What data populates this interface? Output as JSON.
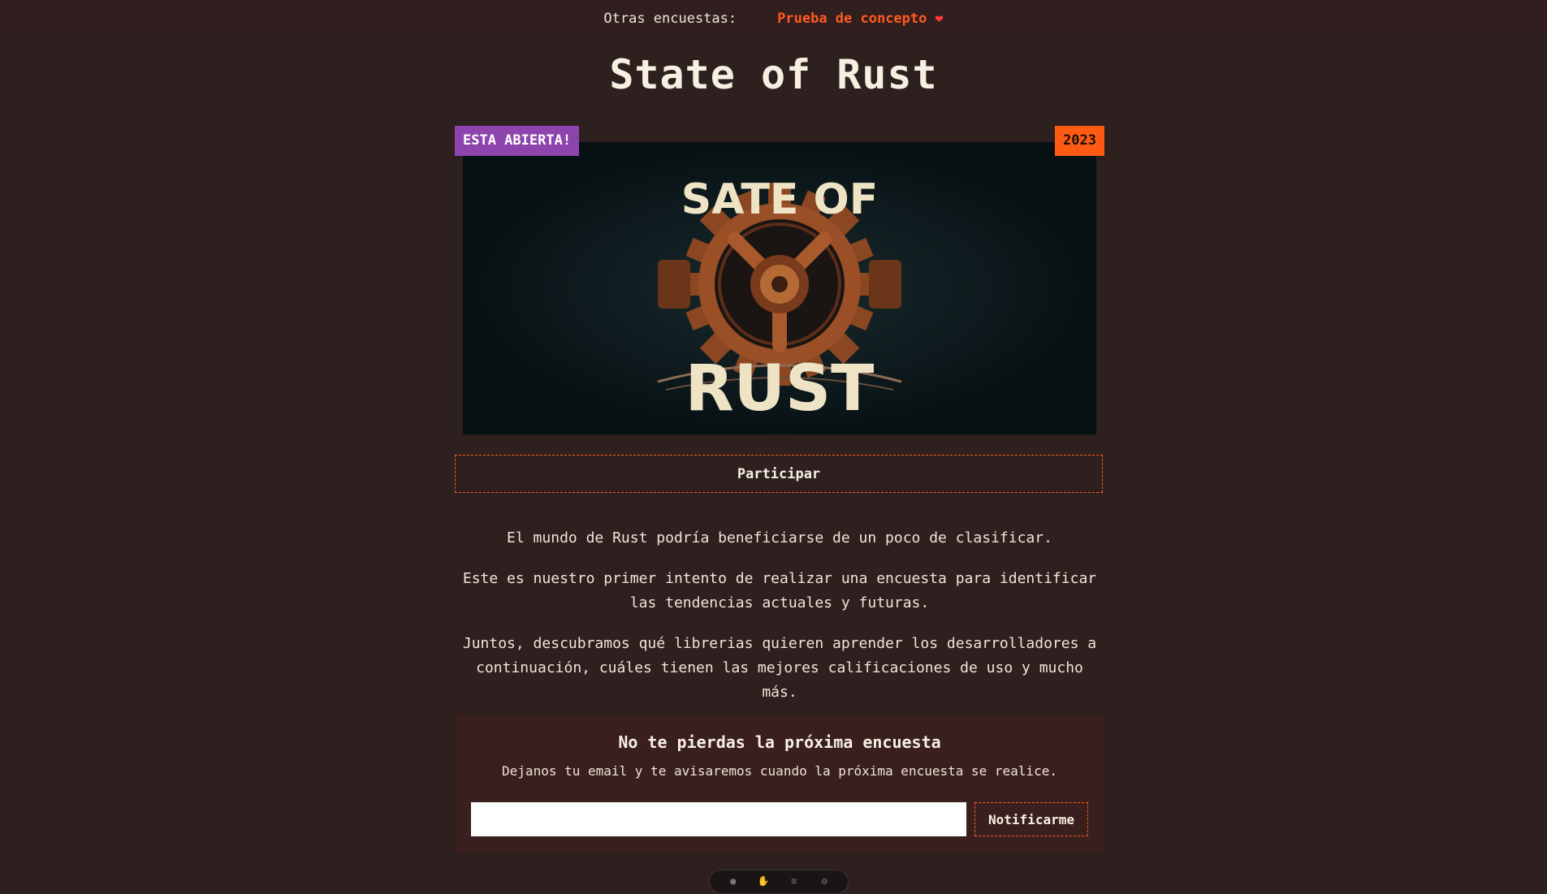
{
  "topbar": {
    "label": "Otras encuestas:",
    "link": "Prueba de concepto",
    "heart": "❤"
  },
  "title": "State of Rust",
  "card": {
    "badge_open": "ESTA ABIERTA!",
    "badge_year": "2023",
    "logo_top": "SATE OF",
    "logo_bottom": "RUST"
  },
  "cta": {
    "participate": "Participar"
  },
  "intro": {
    "p1": "El mundo de Rust podría beneficiarse de un poco de clasificar.",
    "p2": "Este es nuestro primer intento de realizar una encuesta para identificar las tendencias actuales y futuras.",
    "p3": "Juntos, descubramos qué librerias quieren aprender los desarrolladores a continuación, cuáles tienen las mejores calificaciones de uso y mucho más."
  },
  "subscribe": {
    "title": "No te pierdas la próxima encuesta",
    "desc": "Dejanos tu email y te avisaremos cuando la próxima encuesta se realice.",
    "email_value": "",
    "email_placeholder": "",
    "button": "Notificarme"
  },
  "colors": {
    "accent": "#ff5a1f",
    "badge_open": "#8e44ad",
    "badge_year": "#ff5a14",
    "background": "#2d201f"
  }
}
